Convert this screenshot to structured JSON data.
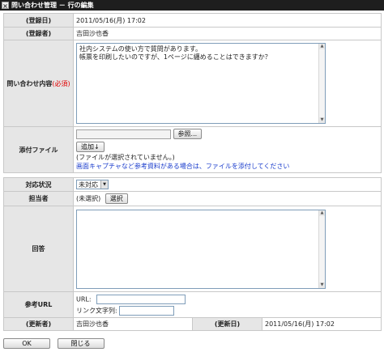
{
  "window": {
    "title": "問い合わせ管理 － 行の編集"
  },
  "registered_date": {
    "label": "(登録日)",
    "value": "2011/05/16(月) 17:02"
  },
  "registered_by": {
    "label": "(登録者)",
    "value": "吉田沙也香"
  },
  "inquiry": {
    "label": "問い合わせ内容",
    "required": "(必須)",
    "line1": "社内システムの使い方で質問があります。",
    "line2": "帳票を印刷したいのですが、1ページに纏めることはできますか？"
  },
  "attachment": {
    "label": "添付ファイル",
    "browse_label": "参照...",
    "add_label": "追加↓",
    "no_file_text": "(ファイルが選択されていません。)",
    "hint_link": "画面キャプチャなど参考資料がある場合は、ファイルを添付してください"
  },
  "status": {
    "label": "対応状況",
    "selected": "未対応"
  },
  "assignee": {
    "label": "担当者",
    "value": "(未選択)",
    "select_label": "選択"
  },
  "answer": {
    "label": "回答"
  },
  "reference_url": {
    "label": "参考URL",
    "url_label": "URL:",
    "link_text_label": "リンク文字列:"
  },
  "updated_by": {
    "label": "(更新者)",
    "value": "吉田沙也香"
  },
  "updated_date": {
    "label": "(更新日)",
    "value": "2011/05/16(月) 17:02"
  },
  "footer": {
    "ok_label": "OK",
    "close_label": "閉じる"
  }
}
